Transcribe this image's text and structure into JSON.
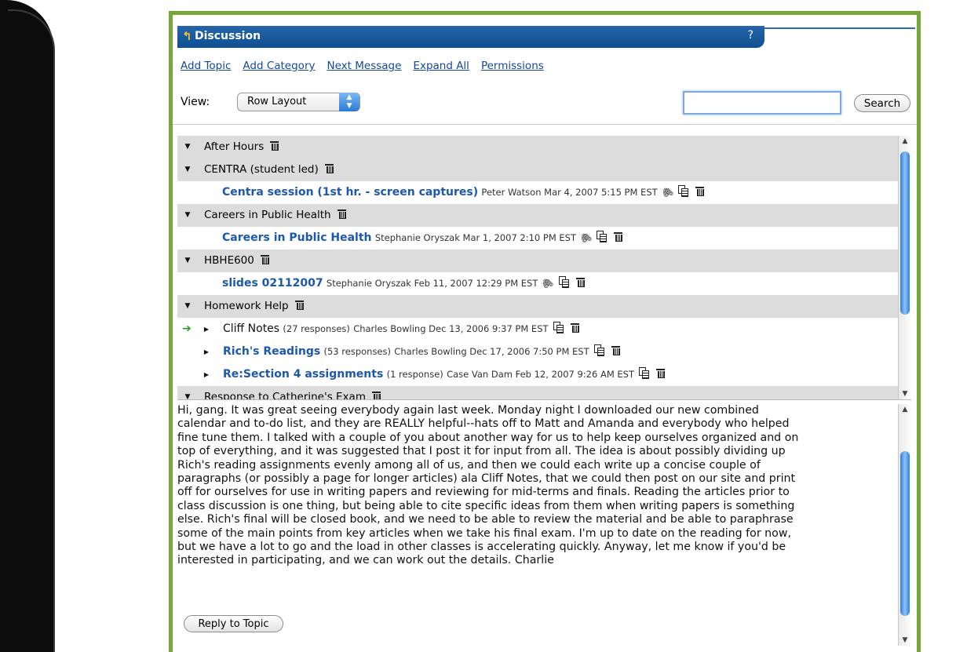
{
  "window": {
    "title": "Discussion",
    "help": "?"
  },
  "toolbar": {
    "links": [
      "Add Topic",
      "Add Category",
      "Next Message",
      "Expand All",
      "Permissions"
    ]
  },
  "view": {
    "label": "View:",
    "selected": "Row Layout"
  },
  "search": {
    "value": "",
    "button": "Search"
  },
  "rows": [
    {
      "kind": "category",
      "label": "After Hours"
    },
    {
      "kind": "category",
      "label": "CENTRA (student led)"
    },
    {
      "kind": "topic",
      "title": "Centra session (1st hr. - screen captures)",
      "meta": "Peter Watson Mar 4, 2007 5:15 PM EST",
      "attachment": true
    },
    {
      "kind": "category",
      "label": "Careers in Public Health"
    },
    {
      "kind": "topic",
      "title": "Careers in Public Health",
      "meta": "Stephanie Oryszak Mar 1, 2007 2:10 PM EST",
      "attachment": true
    },
    {
      "kind": "category",
      "label": "HBHE600"
    },
    {
      "kind": "topic",
      "title": "slides 02112007",
      "meta": "Stephanie Oryszak Feb 11, 2007 12:29 PM EST",
      "attachment": true
    },
    {
      "kind": "category",
      "label": "Homework Help"
    },
    {
      "kind": "thread",
      "title": "Cliff Notes",
      "responses": "(27 responses)",
      "meta": "Charles Bowling Dec 13, 2006 9:37 PM EST",
      "current": true,
      "bold": false
    },
    {
      "kind": "thread",
      "title": "Rich's Readings",
      "responses": "(53 responses)",
      "meta": "Charles Bowling Dec 17, 2006 7:50 PM EST",
      "current": false,
      "bold": true
    },
    {
      "kind": "thread",
      "title": "Re:Section 4 assignments",
      "responses": "(1 response)",
      "meta": "Case Van Dam Feb 12, 2007 9:26 AM EST",
      "current": false,
      "bold": true
    },
    {
      "kind": "category",
      "label": "Response to Catherine's Exam"
    }
  ],
  "message": {
    "lines": [
      "Hi, gang. It was great seeing everybody again last week. Monday night I downloaded our new combined",
      "calendar and to-do list, and they are REALLY helpful--hats off to Matt and Amanda and everybody who helped",
      "fine tune them. I talked with a couple of you about another way for us to help keep ourselves organized and on",
      "top of everything, and it was suggested that I post it for input from all. The idea is about possibly dividing up",
      "Rich's reading assignments evenly among all of us, and then we could each write up a concise couple of",
      "paragraphs (or possibly a page for longer articles) ala Cliff Notes, that we could then post on our site and print",
      "off for ourselves for use in writing papers and reviewing for mid-terms and finals. Reading the articles prior to",
      "class discussion is one thing, but being able to cite specific ideas from them when writing papers is something",
      "else. Rich's final will be closed book, and we need to be able to review the material and be able to paraphrase",
      "some of the main points from key articles when we take his final exam. I'm up to date on the reading for now,",
      "but we have a lot to go and the load in other classes is accelerating quickly. Anyway, let me know if you'd be",
      "interested in participating, and we can work out the details. Charlie"
    ],
    "reply_button": "Reply to Topic"
  },
  "colors": {
    "accent": "#79a63b",
    "titlebar": "#1a5a9c",
    "link": "#15479a",
    "topic": "#1d58b0"
  }
}
